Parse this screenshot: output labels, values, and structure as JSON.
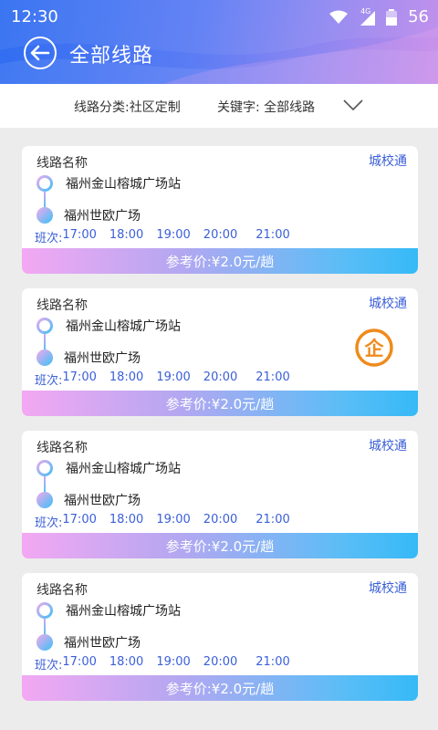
{
  "status_bar": {
    "time": "12:30",
    "network": "4G",
    "battery": "56"
  },
  "nav": {
    "title": "全部线路"
  },
  "filter": {
    "category_text": "线路分类:社区定制",
    "keyword_text": "关键字: 全部线路"
  },
  "cards": [
    {
      "route_label": "线路名称",
      "tag": "城校通",
      "from": "福州金山榕城广场站",
      "to": "福州世欧广场",
      "schedule_prefix": "班次:",
      "times": [
        "17:00",
        "18:00",
        "19:00",
        "20:00",
        "21:00"
      ],
      "price": "参考价:¥2.0元/趟",
      "enterprise": false
    },
    {
      "route_label": "线路名称",
      "tag": "城校通",
      "from": "福州金山榕城广场站",
      "to": "福州世欧广场",
      "schedule_prefix": "班次:",
      "times": [
        "17:00",
        "18:00",
        "19:00",
        "20:00",
        "21:00"
      ],
      "price": "参考价:¥2.0元/趟",
      "enterprise": true,
      "badge": "企"
    },
    {
      "route_label": "线路名称",
      "tag": "城校通",
      "from": "福州金山榕城广场站",
      "to": "福州世欧广场",
      "schedule_prefix": "班次:",
      "times": [
        "17:00",
        "18:00",
        "19:00",
        "20:00",
        "21:00"
      ],
      "price": "参考价:¥2.0元/趟",
      "enterprise": false
    },
    {
      "route_label": "线路名称",
      "tag": "城校通",
      "from": "福州金山榕城广场站",
      "to": "福州世欧广场",
      "schedule_prefix": "班次:",
      "times": [
        "17:00",
        "18:00",
        "19:00",
        "20:00",
        "21:00"
      ],
      "price": "参考价:¥2.0元/趟",
      "enterprise": false
    }
  ],
  "colors": {
    "accent": "#3b5fd8",
    "badge": "#f08a1c"
  }
}
